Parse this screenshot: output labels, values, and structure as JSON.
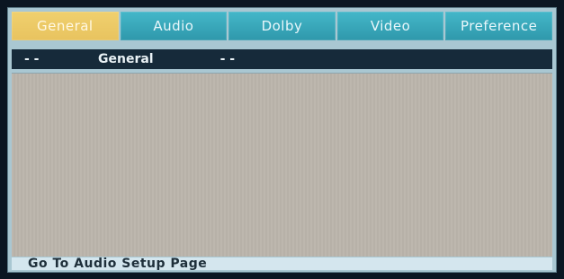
{
  "tabs": [
    {
      "label": "General",
      "active": true
    },
    {
      "label": "Audio",
      "active": false
    },
    {
      "label": "Dolby",
      "active": false
    },
    {
      "label": "Video",
      "active": false
    },
    {
      "label": "Preference",
      "active": false
    }
  ],
  "header": {
    "dash_left": "- -",
    "title": "General",
    "dash_right": "- -"
  },
  "status": {
    "text": "Go To Audio Setup Page"
  },
  "colors": {
    "active_tab": "#e8c35f",
    "inactive_tab": "#2f98ab",
    "header_bar": "#162a3a",
    "content_bg": "#bab4ab",
    "footer_bg": "#d4e6ee"
  }
}
